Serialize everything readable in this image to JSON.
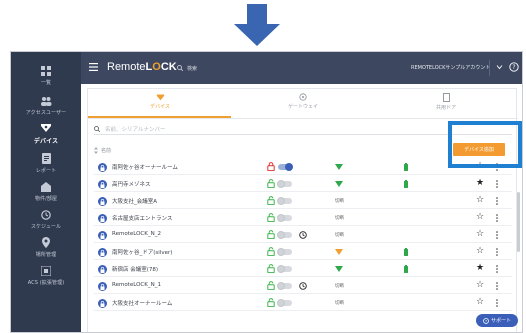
{
  "colors": {
    "sidebar_bg": "#2f3a4f",
    "topbar_bg": "#3d4860",
    "accent_orange": "#f39b31",
    "brand_blue": "#3b5fb8",
    "highlight_blue": "#1f80d1",
    "arrow_blue": "#3a65b0",
    "locked_red": "#d33",
    "unlocked_green": "#3bb54a"
  },
  "sidebar": {
    "items": [
      {
        "label": "一覧",
        "icon": "grid-icon"
      },
      {
        "label": "アクセスユーザー",
        "icon": "users-icon"
      },
      {
        "label": "デバイス",
        "icon": "device-icon",
        "active": true
      },
      {
        "label": "レポート",
        "icon": "report-icon"
      },
      {
        "label": "物件/部屋",
        "icon": "building-icon"
      },
      {
        "label": "スケジュール",
        "icon": "clock-icon"
      },
      {
        "label": "場所管理",
        "icon": "location-icon"
      },
      {
        "label": "ACS (拡張管理)",
        "icon": "acs-icon"
      }
    ]
  },
  "topbar": {
    "brand_part1": "Remote",
    "brand_part2": "L",
    "brand_o": "O",
    "brand_part3": "CK",
    "search_label": "検索",
    "account": "REMOTELOCKサンプルアカウント"
  },
  "tabs": [
    {
      "label": "デバイス",
      "icon": "device-icon",
      "active": true
    },
    {
      "label": "ゲートウェイ",
      "icon": "gateway-icon"
    },
    {
      "label": "共用ドア",
      "icon": "door-icon"
    }
  ],
  "search": {
    "placeholder": "名前、シリアルナンバー"
  },
  "list": {
    "column_name": "名前",
    "add_button": "デバイス追加",
    "rows": [
      {
        "name": "南阿佐ヶ谷オーナールーム",
        "locked": true,
        "toggle_on": true,
        "clock": false,
        "wifi": true,
        "wifi_color": "#2ea84a",
        "status": "",
        "battery": true,
        "battery_color": "#2ea84a",
        "star_filled": false
      },
      {
        "name": "高円寺メゾネス",
        "locked": false,
        "toggle_on": false,
        "clock": false,
        "wifi": true,
        "wifi_color": "#2ea84a",
        "status": "",
        "battery": true,
        "battery_color": "#2ea84a",
        "star_filled": true
      },
      {
        "name": "大阪支社_会議室A",
        "locked": false,
        "toggle_on": false,
        "clock": false,
        "wifi": false,
        "wifi_color": "",
        "status": "切断",
        "battery": false,
        "battery_color": "",
        "star_filled": false
      },
      {
        "name": "名古屋支店エントランス",
        "locked": false,
        "toggle_on": false,
        "clock": false,
        "wifi": false,
        "wifi_color": "",
        "status": "切断",
        "battery": false,
        "battery_color": "",
        "star_filled": false
      },
      {
        "name": "RemoteLOCK_N_2",
        "locked": false,
        "toggle_on": false,
        "clock": true,
        "wifi": false,
        "wifi_color": "",
        "status": "切断",
        "battery": false,
        "battery_color": "",
        "star_filled": false
      },
      {
        "name": "南阿佐ヶ谷_ドア(silver)",
        "locked": false,
        "toggle_on": false,
        "clock": false,
        "wifi": true,
        "wifi_color": "#f0a030",
        "status": "",
        "battery": true,
        "battery_color": "#2ea84a",
        "star_filled": false
      },
      {
        "name": "新宿店 会議室(78)",
        "locked": false,
        "toggle_on": false,
        "clock": false,
        "wifi": true,
        "wifi_color": "#2ea84a",
        "status": "",
        "battery": true,
        "battery_color": "#2ea84a",
        "star_filled": true
      },
      {
        "name": "RemoteLOCK_N_1",
        "locked": false,
        "toggle_on": false,
        "clock": true,
        "wifi": false,
        "wifi_color": "",
        "status": "切断",
        "battery": false,
        "battery_color": "",
        "star_filled": false
      },
      {
        "name": "大阪支社オーナールーム",
        "locked": false,
        "toggle_on": false,
        "clock": false,
        "wifi": false,
        "wifi_color": "",
        "status": "切断",
        "battery": false,
        "battery_color": "",
        "star_filled": false
      }
    ]
  },
  "support_button": "サポート"
}
